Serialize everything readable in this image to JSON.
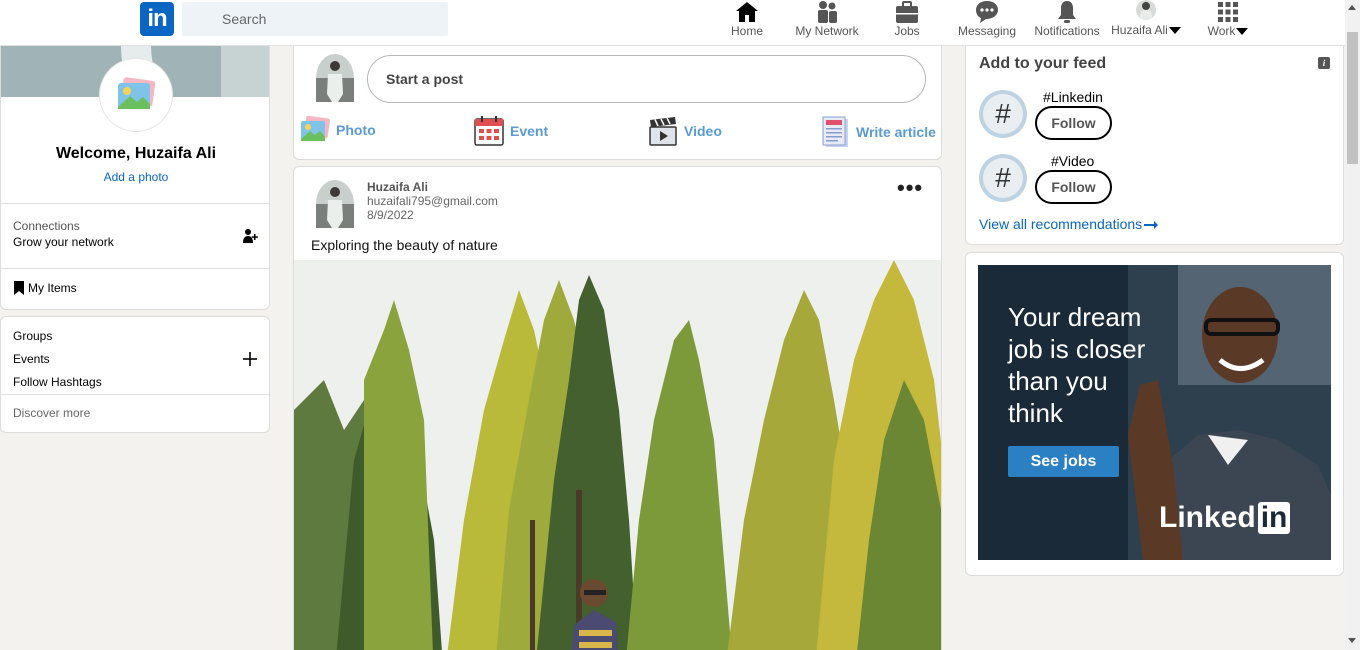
{
  "header": {
    "logo_text": "in",
    "search_placeholder": "Search",
    "nav": [
      {
        "label": "Home",
        "icon": "home-icon"
      },
      {
        "label": "My Network",
        "icon": "my-network-icon"
      },
      {
        "label": "Jobs",
        "icon": "jobs-icon"
      },
      {
        "label": "Messaging",
        "icon": "messaging-icon"
      },
      {
        "label": "Notifications",
        "icon": "bell-icon"
      },
      {
        "label": "Huzaifa Ali",
        "icon": "avatar"
      },
      {
        "label": "Work",
        "icon": "grid-icon"
      }
    ]
  },
  "profile": {
    "welcome": "Welcome, Huzaifa Ali",
    "add_photo": "Add a photo",
    "connections_title": "Connections",
    "connections_sub": "Grow your network",
    "my_items": "My Items"
  },
  "groups": {
    "items": [
      "Groups",
      "Events",
      "Follow Hashtags"
    ],
    "discover": "Discover more"
  },
  "share_box": {
    "start_post": "Start a post",
    "actions": [
      {
        "label": "Photo",
        "icon": "photo-icon"
      },
      {
        "label": "Event",
        "icon": "calendar-icon"
      },
      {
        "label": "Video",
        "icon": "video-icon"
      },
      {
        "label": "Write article",
        "icon": "article-icon"
      }
    ]
  },
  "post": {
    "author": "Huzaifa Ali",
    "email": "huzaifali795@gmail.com",
    "date": "8/9/2022",
    "text": "Exploring the beauty of nature",
    "more": "•••"
  },
  "feed_recs": {
    "title": "Add to your feed",
    "items": [
      {
        "tag": "#Linkedin",
        "follow": "Follow"
      },
      {
        "tag": "#Video",
        "follow": "Follow"
      }
    ],
    "view_all": "View all recommendations"
  },
  "ad": {
    "headline_lines": [
      "Your dream",
      "job is closer",
      "than you",
      "think"
    ],
    "cta": "See jobs",
    "brand": "Linked",
    "brand_box": "in"
  },
  "colors": {
    "brand": "#0a66c2",
    "action_text": "#5b9bd5",
    "background": "#f3f2ef"
  }
}
